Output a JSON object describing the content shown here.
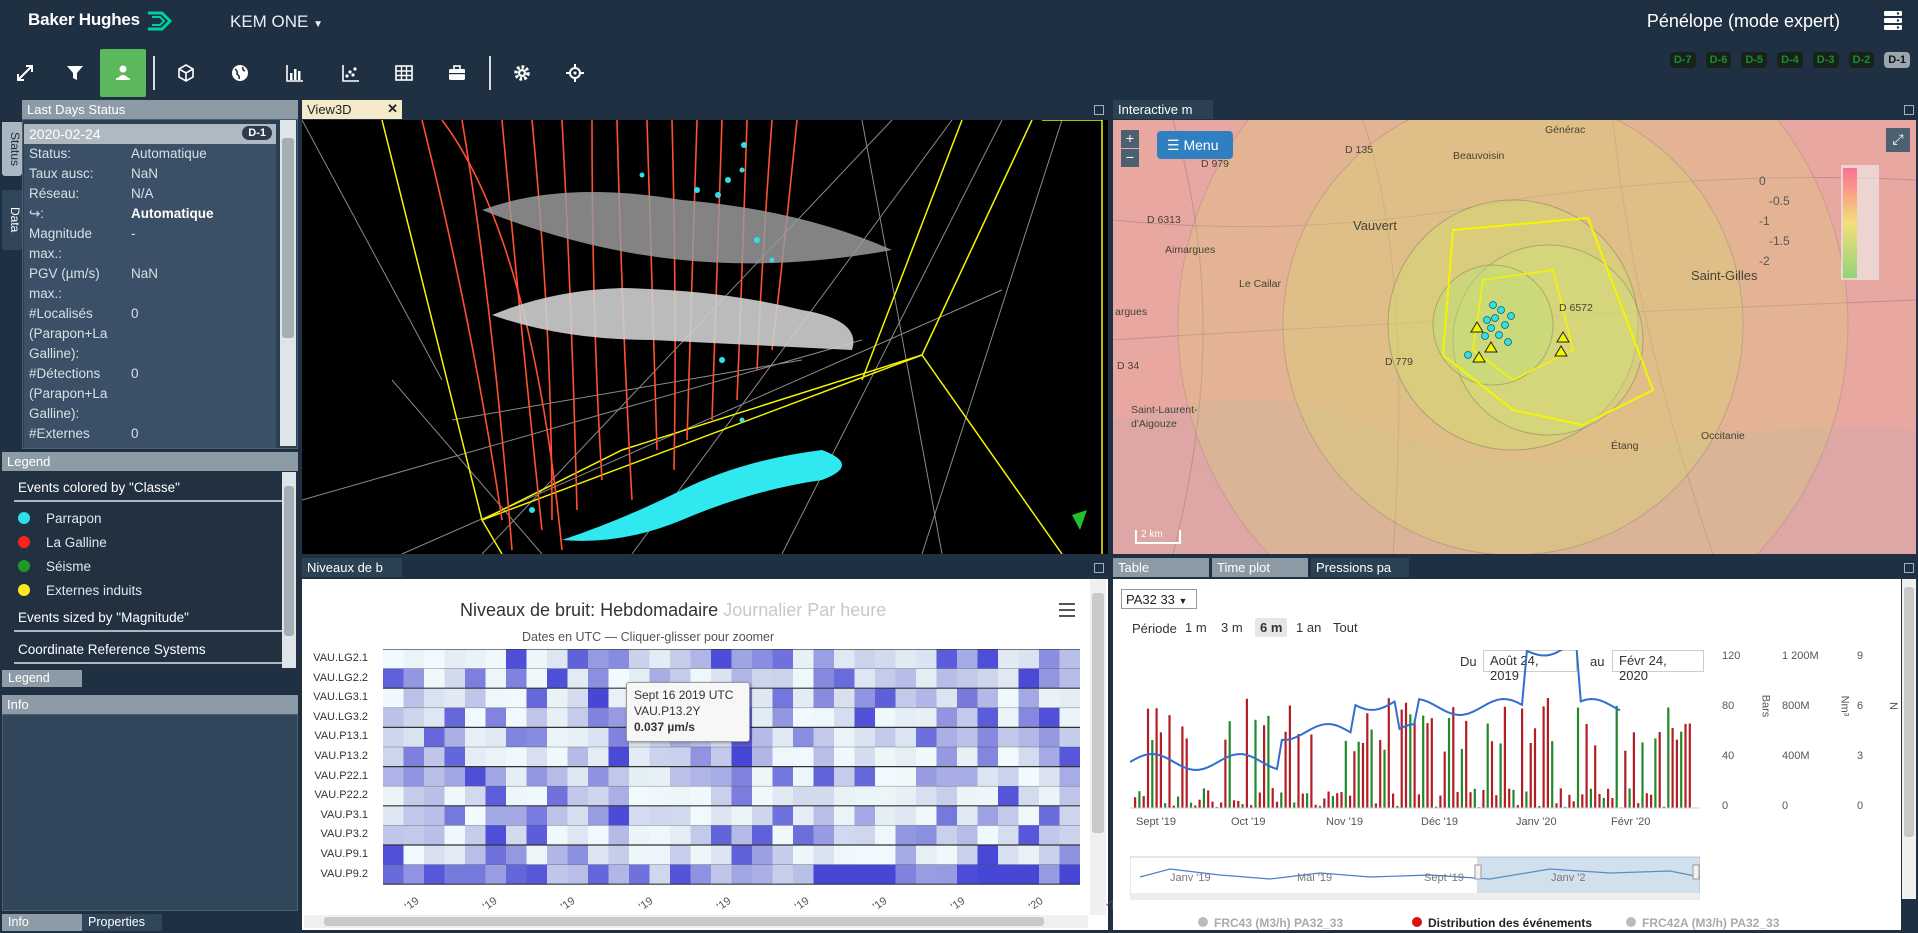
{
  "header": {
    "brand": "Baker Hughes",
    "project": "KEM ONE",
    "user": "Pénélope (mode expert)"
  },
  "toolbar": {
    "icons": [
      "expand-icon",
      "filter-icon",
      "user-map-icon",
      "cube-icon",
      "globe-icon",
      "bar-chart-icon",
      "scatter-icon",
      "table-icon",
      "briefcase-icon",
      "gear-icon",
      "crosshair-icon"
    ]
  },
  "days": [
    "D-7",
    "D-6",
    "D-5",
    "D-4",
    "D-3",
    "D-2",
    "D-1"
  ],
  "status_panel": {
    "title": "Last Days Status",
    "side_tabs": [
      "Status",
      "Data"
    ],
    "date": "2020-02-24",
    "badge": "D-1",
    "rows": [
      {
        "k": "Status:",
        "v": "Automatique",
        "bold": false
      },
      {
        "k": "Taux ausc:",
        "v": "NaN",
        "bold": false
      },
      {
        "k": "Réseau:",
        "v": "N/A",
        "bold": false
      },
      {
        "k": "↪:",
        "v": "Automatique",
        "bold": true
      },
      {
        "k": "Magnitude",
        "v": "-",
        "bold": false
      },
      {
        "k": "max.:",
        "v": "",
        "bold": false
      },
      {
        "k": "PGV (µm/s)",
        "v": "NaN",
        "bold": false
      },
      {
        "k": "max.:",
        "v": "",
        "bold": false
      },
      {
        "k": "#Localisés",
        "v": "0",
        "bold": false
      },
      {
        "k": "(Parapon+La",
        "v": "",
        "bold": false
      },
      {
        "k": "Galline):",
        "v": "",
        "bold": false
      },
      {
        "k": "#Détections",
        "v": "0",
        "bold": false
      },
      {
        "k": "(Parapon+La",
        "v": "",
        "bold": false
      },
      {
        "k": "Galline):",
        "v": "",
        "bold": false
      },
      {
        "k": "#Externes",
        "v": "0",
        "bold": false
      }
    ]
  },
  "legend_panel": {
    "title": "Legend",
    "colored_by": "Events colored by \"Classe\"",
    "items": [
      {
        "label": "Parrapon",
        "color": "#2fe0e8"
      },
      {
        "label": "La Galline",
        "color": "#ff2020"
      },
      {
        "label": "Séisme",
        "color": "#1e9a2a"
      },
      {
        "label": "Externes induits",
        "color": "#ffe820"
      }
    ],
    "sized_by": "Events sized by \"Magnitude\"",
    "crs": "Coordinate Reference Systems",
    "tab": "Legend"
  },
  "info_panel": {
    "title": "Info",
    "tabs": [
      "Info",
      "Properties"
    ]
  },
  "view3d": {
    "tab": "View3D"
  },
  "map": {
    "tab": "Interactive m",
    "menu": "Menu",
    "zoom_in": "+",
    "zoom_out": "−",
    "scale": "2 km",
    "places": [
      {
        "t": "Générac"
      },
      {
        "t": "D 135"
      },
      {
        "t": "Beauvoisin"
      },
      {
        "t": "D 979"
      },
      {
        "t": "D 6313"
      },
      {
        "t": "Vauvert"
      },
      {
        "t": "Aimargues"
      },
      {
        "t": "Le Cailar"
      },
      {
        "t": "Saint-Gilles"
      },
      {
        "t": "D 6572"
      },
      {
        "t": "argues"
      },
      {
        "t": "D 779"
      },
      {
        "t": "D 34"
      },
      {
        "t": "Saint-Laurent-"
      },
      {
        "t": "d'Aigouze"
      },
      {
        "t": "Étang"
      },
      {
        "t": "Occitanie"
      }
    ],
    "colorbar_labels": [
      "0",
      "-0.5",
      "-1",
      "-1.5",
      "-2"
    ]
  },
  "noise": {
    "tab": "Niveaux de b",
    "title": "Niveaux de bruit:",
    "modes": [
      "Hebdomadaire",
      "Journalier",
      "Par heure"
    ],
    "subtitle": "Dates en UTC — Cliquer-glisser pour zoomer",
    "stations": [
      "VAU.LG2.1",
      "VAU.LG2.2",
      "VAU.LG3.1",
      "VAU.LG3.2",
      "VAU.P13.1",
      "VAU.P13.2",
      "VAU.P22.1",
      "VAU.P22.2",
      "VAU.P3.1",
      "VAU.P3.2",
      "VAU.P9.1",
      "VAU.P9.2"
    ],
    "x_ticks": [
      "'19",
      "'19",
      "'19",
      "'19",
      "'19",
      "'19",
      "'19",
      "'19",
      "'20",
      "'20"
    ],
    "tooltip": {
      "date": "Sept 16 2019 UTC",
      "station": "VAU.P13.2Y",
      "value": "0.037 µm/s"
    }
  },
  "pressure": {
    "tabs": [
      "Table",
      "Time plot",
      "Pressions pa"
    ],
    "selector": "PA32 33",
    "period_label": "Période",
    "periods": [
      "1 m",
      "3 m",
      "6 m",
      "1 an",
      "Tout"
    ],
    "selected_period": "6 m",
    "from_label": "Du",
    "from": "Août 24, 2019",
    "to_label": "au",
    "to": "Févr 24, 2020",
    "x_ticks": [
      "Sept '19",
      "Oct '19",
      "Nov '19",
      "Déc '19",
      "Janv '20",
      "Févr '20"
    ],
    "axes": [
      {
        "unit": "Bars",
        "ticks": [
          "120",
          "80",
          "40",
          "0"
        ]
      },
      {
        "unit": "Nm³",
        "ticks": [
          "1 200M",
          "800M",
          "400M",
          "0"
        ]
      },
      {
        "unit": "N",
        "ticks": [
          "9",
          "6",
          "3",
          "0"
        ]
      }
    ],
    "nav_labels": [
      "Janv '19",
      "Mai '19",
      "Sept '19",
      "Janv '2"
    ],
    "legend": [
      "FRC43 (M3/h) PA32_33",
      "Distribution des événements",
      "FRC42A (M3/h) PA32_33"
    ]
  }
}
